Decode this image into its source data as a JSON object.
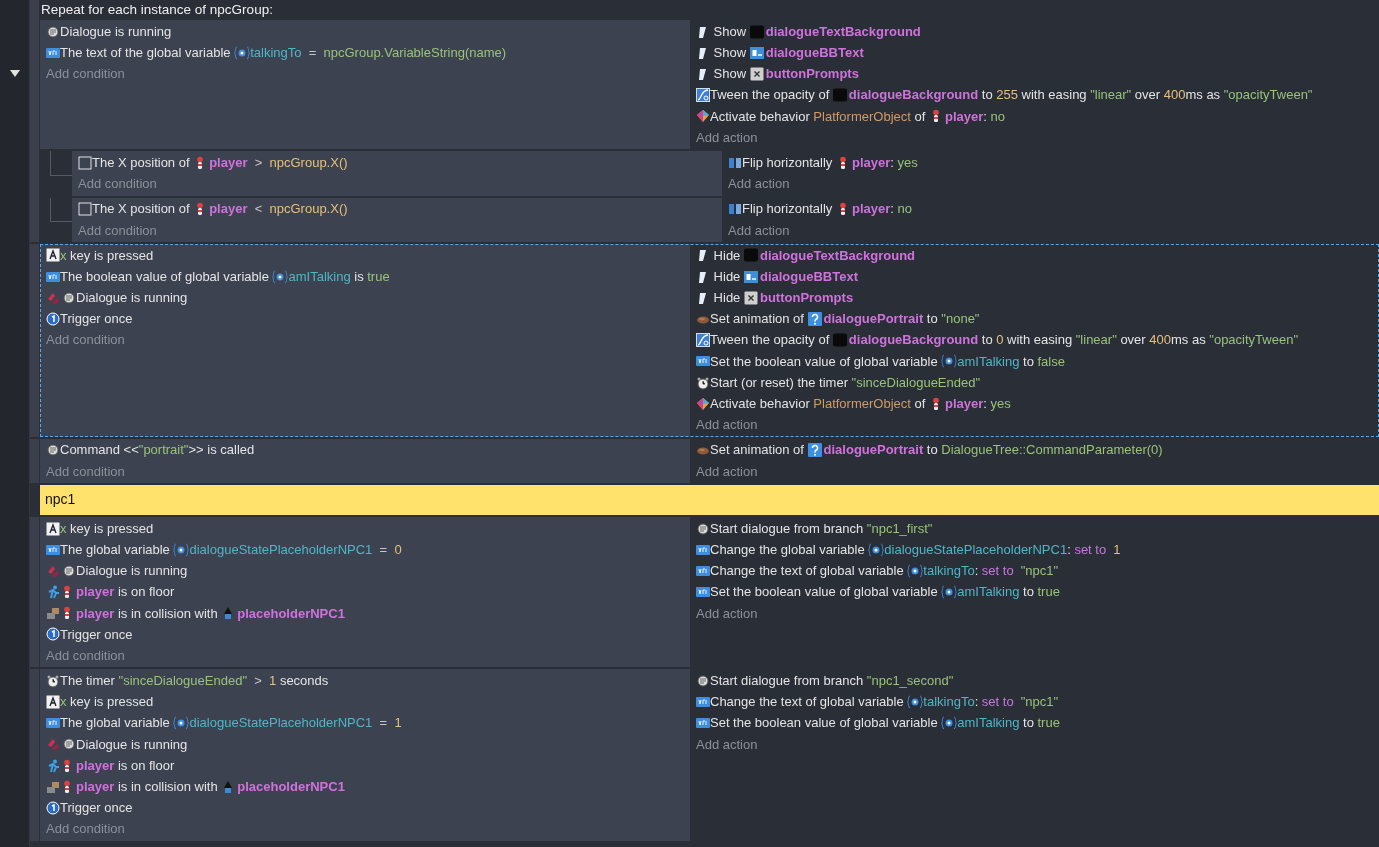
{
  "events": [
    {
      "kind": "repeat",
      "selected": false,
      "header": "Repeat for each instance of npcGroup:",
      "conditions": [
        {
          "kind": "dialogue",
          "parts": [
            {
              "kind": "text",
              "text": "Dialogue is running"
            }
          ]
        },
        {
          "kind": "variable",
          "parts": [
            {
              "kind": "text",
              "text": "The text of the global variable "
            },
            {
              "kind": "variable",
              "text": "talkingTo"
            },
            {
              "kind": "operator",
              "text": "  =  "
            },
            {
              "kind": "string",
              "text": "npcGroup.VariableString(name)"
            }
          ]
        }
      ],
      "add_condition": "Add condition",
      "actions": [
        {
          "kind": "visibility",
          "parts": [
            {
              "kind": "text",
              "text": " Show "
            },
            {
              "kind": "object-dark",
              "text": "dialogueTextBackground"
            }
          ]
        },
        {
          "kind": "visibility",
          "parts": [
            {
              "kind": "text",
              "text": " Show "
            },
            {
              "kind": "object-bbtext",
              "text": "dialogueBBText"
            }
          ]
        },
        {
          "kind": "visibility",
          "parts": [
            {
              "kind": "text",
              "text": " Show "
            },
            {
              "kind": "object-prompt",
              "text": "buttonPrompts"
            }
          ]
        },
        {
          "kind": "tween",
          "parts": [
            {
              "kind": "text",
              "text": "Tween the opacity of "
            },
            {
              "kind": "object-dark",
              "text": "dialogueBackground"
            },
            {
              "kind": "text",
              "text": " to "
            },
            {
              "kind": "value",
              "text": "255"
            },
            {
              "kind": "text",
              "text": " with easing "
            },
            {
              "kind": "string",
              "text": "\"linear\""
            },
            {
              "kind": "text",
              "text": " over "
            },
            {
              "kind": "value",
              "text": "400"
            },
            {
              "kind": "text",
              "text": "ms as "
            },
            {
              "kind": "string",
              "text": "\"opacityTween\""
            }
          ]
        },
        {
          "kind": "behavior",
          "parts": [
            {
              "kind": "text",
              "text": "Activate behavior "
            },
            {
              "kind": "behavior",
              "text": "PlatformerObject"
            },
            {
              "kind": "text",
              "text": " of "
            },
            {
              "kind": "object-sprite",
              "text": "player"
            },
            {
              "kind": "text",
              "text": ": "
            },
            {
              "kind": "string",
              "text": "no"
            }
          ]
        }
      ],
      "add_action": "Add action",
      "children": [
        {
          "kind": "standard",
          "selected": false,
          "conditions": [
            {
              "kind": "position",
              "parts": [
                {
                  "kind": "text",
                  "text": "The X position of "
                },
                {
                  "kind": "object-sprite",
                  "text": "player"
                },
                {
                  "kind": "operator",
                  "text": "  >  "
                },
                {
                  "kind": "value",
                  "text": "npcGroup.X()"
                }
              ]
            }
          ],
          "add_condition": "Add condition",
          "actions": [
            {
              "kind": "flip",
              "parts": [
                {
                  "kind": "text",
                  "text": "Flip horizontally "
                },
                {
                  "kind": "object-sprite",
                  "text": "player"
                },
                {
                  "kind": "text",
                  "text": ": "
                },
                {
                  "kind": "string",
                  "text": "yes"
                }
              ]
            }
          ],
          "add_action": "Add action"
        },
        {
          "kind": "standard",
          "selected": false,
          "conditions": [
            {
              "kind": "position",
              "parts": [
                {
                  "kind": "text",
                  "text": "The X position of "
                },
                {
                  "kind": "object-sprite",
                  "text": "player"
                },
                {
                  "kind": "operator",
                  "text": "  <  "
                },
                {
                  "kind": "value",
                  "text": "npcGroup.X()"
                }
              ]
            }
          ],
          "add_condition": "Add condition",
          "actions": [
            {
              "kind": "flip",
              "parts": [
                {
                  "kind": "text",
                  "text": "Flip horizontally "
                },
                {
                  "kind": "object-sprite",
                  "text": "player"
                },
                {
                  "kind": "text",
                  "text": ": "
                },
                {
                  "kind": "string",
                  "text": "no"
                }
              ]
            }
          ],
          "add_action": "Add action"
        }
      ]
    },
    {
      "kind": "standard",
      "selected": true,
      "conditions": [
        {
          "kind": "key",
          "parts": [
            {
              "kind": "string",
              "text": "x"
            },
            {
              "kind": "text",
              "text": " key is pressed"
            }
          ]
        },
        {
          "kind": "variable",
          "parts": [
            {
              "kind": "text",
              "text": "The boolean value of global variable "
            },
            {
              "kind": "variable",
              "text": "amITalking"
            },
            {
              "kind": "text",
              "text": " is "
            },
            {
              "kind": "string",
              "text": "true"
            }
          ]
        },
        {
          "kind": "inverted-dialogue",
          "parts": [
            {
              "kind": "text",
              "text": "Dialogue is running"
            }
          ]
        },
        {
          "kind": "trigger",
          "parts": [
            {
              "kind": "text",
              "text": "Trigger once"
            }
          ]
        }
      ],
      "add_condition": "Add condition",
      "actions": [
        {
          "kind": "visibility",
          "parts": [
            {
              "kind": "text",
              "text": " Hide "
            },
            {
              "kind": "object-dark",
              "text": "dialogueTextBackground"
            }
          ]
        },
        {
          "kind": "visibility",
          "parts": [
            {
              "kind": "text",
              "text": " Hide "
            },
            {
              "kind": "object-bbtext",
              "text": "dialogueBBText"
            }
          ]
        },
        {
          "kind": "visibility",
          "parts": [
            {
              "kind": "text",
              "text": " Hide "
            },
            {
              "kind": "object-prompt",
              "text": "buttonPrompts"
            }
          ]
        },
        {
          "kind": "animation",
          "parts": [
            {
              "kind": "text",
              "text": "Set animation of "
            },
            {
              "kind": "object-portrait",
              "text": "dialoguePortrait"
            },
            {
              "kind": "text",
              "text": " to "
            },
            {
              "kind": "string",
              "text": "\"none\""
            }
          ]
        },
        {
          "kind": "tween",
          "parts": [
            {
              "kind": "text",
              "text": "Tween the opacity of "
            },
            {
              "kind": "object-dark",
              "text": "dialogueBackground"
            },
            {
              "kind": "text",
              "text": " to "
            },
            {
              "kind": "value",
              "text": "0"
            },
            {
              "kind": "text",
              "text": " with easing "
            },
            {
              "kind": "string",
              "text": "\"linear\""
            },
            {
              "kind": "text",
              "text": " over "
            },
            {
              "kind": "value",
              "text": "400"
            },
            {
              "kind": "text",
              "text": "ms as "
            },
            {
              "kind": "string",
              "text": "\"opacityTween\""
            }
          ]
        },
        {
          "kind": "variable",
          "parts": [
            {
              "kind": "text",
              "text": "Set the boolean value of global variable "
            },
            {
              "kind": "variable",
              "text": "amITalking"
            },
            {
              "kind": "text",
              "text": " to "
            },
            {
              "kind": "string",
              "text": "false"
            }
          ]
        },
        {
          "kind": "timer",
          "parts": [
            {
              "kind": "text",
              "text": "Start (or reset) the timer "
            },
            {
              "kind": "string",
              "text": "\"sinceDialogueEnded\""
            }
          ]
        },
        {
          "kind": "behavior",
          "parts": [
            {
              "kind": "text",
              "text": "Activate behavior "
            },
            {
              "kind": "behavior",
              "text": "PlatformerObject"
            },
            {
              "kind": "text",
              "text": " of "
            },
            {
              "kind": "object-sprite",
              "text": "player"
            },
            {
              "kind": "text",
              "text": ": "
            },
            {
              "kind": "string",
              "text": "yes"
            }
          ]
        }
      ],
      "add_action": "Add action"
    },
    {
      "kind": "standard",
      "selected": false,
      "conditions": [
        {
          "kind": "dialogue",
          "parts": [
            {
              "kind": "text",
              "text": "Command <<"
            },
            {
              "kind": "string",
              "text": "\"portrait\""
            },
            {
              "kind": "text",
              "text": ">> is called"
            }
          ]
        }
      ],
      "add_condition": "Add condition",
      "actions": [
        {
          "kind": "animation",
          "parts": [
            {
              "kind": "text",
              "text": "Set animation of "
            },
            {
              "kind": "object-portrait",
              "text": "dialoguePortrait"
            },
            {
              "kind": "text",
              "text": " to "
            },
            {
              "kind": "string",
              "text": "DialogueTree::CommandParameter(0)"
            }
          ]
        }
      ],
      "add_action": "Add action"
    },
    {
      "kind": "comment",
      "text": "npc1"
    },
    {
      "kind": "standard",
      "selected": false,
      "conditions": [
        {
          "kind": "key",
          "parts": [
            {
              "kind": "string",
              "text": "x"
            },
            {
              "kind": "text",
              "text": " key is pressed"
            }
          ]
        },
        {
          "kind": "variable",
          "parts": [
            {
              "kind": "text",
              "text": "The global variable "
            },
            {
              "kind": "variable",
              "text": "dialogueStatePlaceholderNPC1"
            },
            {
              "kind": "operator",
              "text": "  =  "
            },
            {
              "kind": "value",
              "text": "0"
            }
          ]
        },
        {
          "kind": "inverted-dialogue",
          "parts": [
            {
              "kind": "text",
              "text": "Dialogue is running"
            }
          ]
        },
        {
          "kind": "platformer",
          "parts": [
            {
              "kind": "object-sprite",
              "text": "player"
            },
            {
              "kind": "text",
              "text": " is on floor"
            }
          ]
        },
        {
          "kind": "collision",
          "parts": [
            {
              "kind": "object-sprite",
              "text": "player"
            },
            {
              "kind": "text",
              "text": " is in collision with "
            },
            {
              "kind": "object-npc",
              "text": "placeholderNPC1"
            }
          ]
        },
        {
          "kind": "trigger",
          "parts": [
            {
              "kind": "text",
              "text": "Trigger once"
            }
          ]
        }
      ],
      "add_condition": "Add condition",
      "actions": [
        {
          "kind": "dialogue",
          "parts": [
            {
              "kind": "text",
              "text": "Start dialogue from branch "
            },
            {
              "kind": "string",
              "text": "\"npc1_first\""
            }
          ]
        },
        {
          "kind": "variable",
          "parts": [
            {
              "kind": "text",
              "text": "Change the global variable "
            },
            {
              "kind": "variable",
              "text": "dialogueStatePlaceholderNPC1"
            },
            {
              "kind": "text",
              "text": ": "
            },
            {
              "kind": "keyword",
              "text": "set to"
            },
            {
              "kind": "value",
              "text": "1"
            }
          ]
        },
        {
          "kind": "variable",
          "parts": [
            {
              "kind": "text",
              "text": "Change the text of global variable "
            },
            {
              "kind": "variable",
              "text": "talkingTo"
            },
            {
              "kind": "text",
              "text": ": "
            },
            {
              "kind": "keyword",
              "text": "set to"
            },
            {
              "kind": "string",
              "text": "\"npc1\""
            }
          ]
        },
        {
          "kind": "variable",
          "parts": [
            {
              "kind": "text",
              "text": "Set the boolean value of global variable "
            },
            {
              "kind": "variable",
              "text": "amITalking"
            },
            {
              "kind": "text",
              "text": " to "
            },
            {
              "kind": "string",
              "text": "true"
            }
          ]
        }
      ],
      "add_action": "Add action"
    },
    {
      "kind": "standard",
      "selected": false,
      "conditions": [
        {
          "kind": "timer",
          "parts": [
            {
              "kind": "text",
              "text": "The timer "
            },
            {
              "kind": "string",
              "text": "\"sinceDialogueEnded\""
            },
            {
              "kind": "operator",
              "text": "  >  "
            },
            {
              "kind": "value",
              "text": "1"
            },
            {
              "kind": "text",
              "text": " seconds"
            }
          ]
        },
        {
          "kind": "key",
          "parts": [
            {
              "kind": "string",
              "text": "x"
            },
            {
              "kind": "text",
              "text": " key is pressed"
            }
          ]
        },
        {
          "kind": "variable",
          "parts": [
            {
              "kind": "text",
              "text": "The global variable "
            },
            {
              "kind": "variable",
              "text": "dialogueStatePlaceholderNPC1"
            },
            {
              "kind": "operator",
              "text": "  =  "
            },
            {
              "kind": "value",
              "text": "1"
            }
          ]
        },
        {
          "kind": "inverted-dialogue",
          "parts": [
            {
              "kind": "text",
              "text": "Dialogue is running"
            }
          ]
        },
        {
          "kind": "platformer",
          "parts": [
            {
              "kind": "object-sprite",
              "text": "player"
            },
            {
              "kind": "text",
              "text": " is on floor"
            }
          ]
        },
        {
          "kind": "collision",
          "parts": [
            {
              "kind": "object-sprite",
              "text": "player"
            },
            {
              "kind": "text",
              "text": " is in collision with "
            },
            {
              "kind": "object-npc",
              "text": "placeholderNPC1"
            }
          ]
        },
        {
          "kind": "trigger",
          "parts": [
            {
              "kind": "text",
              "text": "Trigger once"
            }
          ]
        }
      ],
      "add_condition": "Add condition",
      "actions": [
        {
          "kind": "dialogue",
          "parts": [
            {
              "kind": "text",
              "text": "Start dialogue from branch "
            },
            {
              "kind": "string",
              "text": "\"npc1_second\""
            }
          ]
        },
        {
          "kind": "variable",
          "parts": [
            {
              "kind": "text",
              "text": "Change the text of global variable "
            },
            {
              "kind": "variable",
              "text": "talkingTo"
            },
            {
              "kind": "text",
              "text": ": "
            },
            {
              "kind": "keyword",
              "text": "set to"
            },
            {
              "kind": "string",
              "text": "\"npc1\""
            }
          ]
        },
        {
          "kind": "variable",
          "parts": [
            {
              "kind": "text",
              "text": "Set the boolean value of global variable "
            },
            {
              "kind": "variable",
              "text": "amITalking"
            },
            {
              "kind": "text",
              "text": " to "
            },
            {
              "kind": "string",
              "text": "true"
            }
          ]
        }
      ],
      "add_action": "Add action"
    }
  ]
}
